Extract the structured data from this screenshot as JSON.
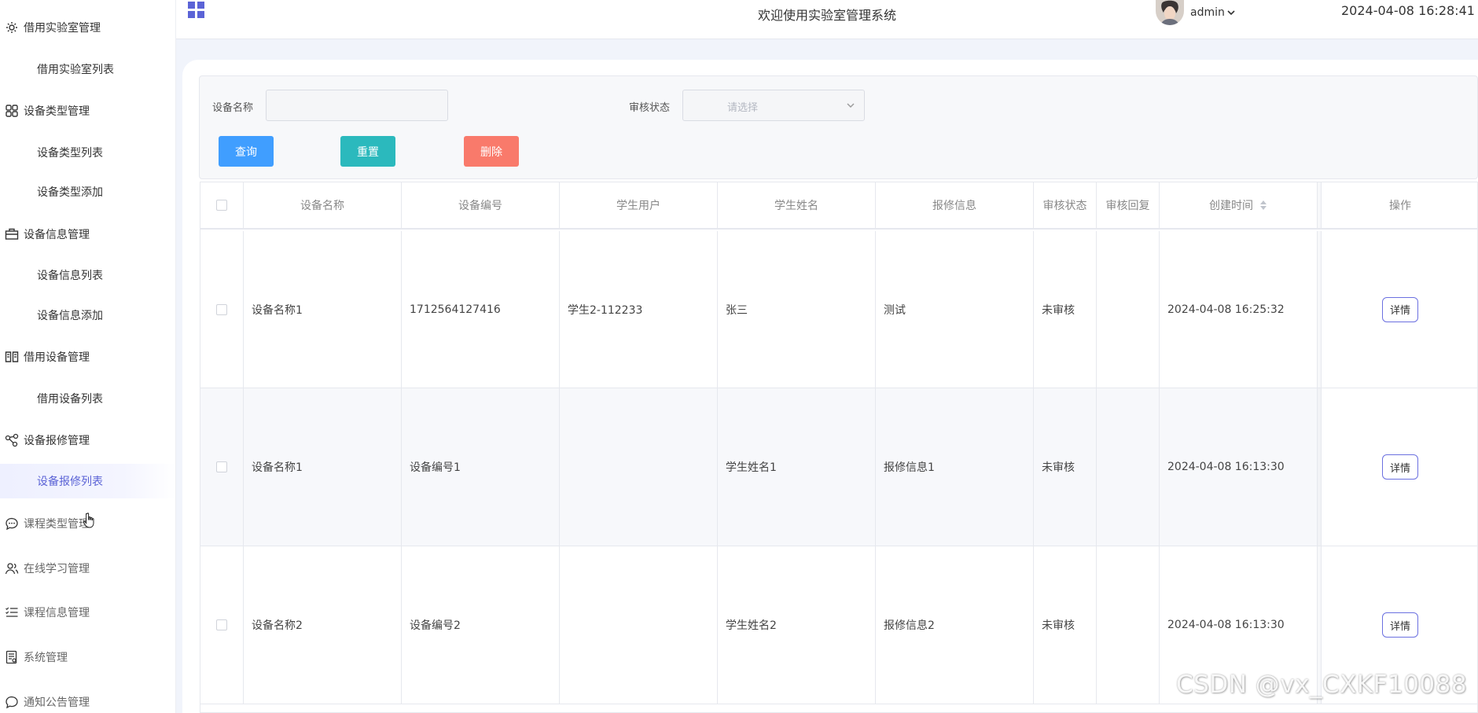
{
  "header": {
    "title": "欢迎使用实验室管理系统",
    "username": "admin",
    "datetime": "2024-04-08 16:28:41"
  },
  "sidebar": {
    "groups": [
      {
        "label": "借用实验室管理",
        "icon": "gear-icon",
        "items": [
          "借用实验室列表"
        ]
      },
      {
        "label": "设备类型管理",
        "icon": "grid-icon",
        "items": [
          "设备类型列表",
          "设备类型添加"
        ]
      },
      {
        "label": "设备信息管理",
        "icon": "briefcase-icon",
        "items": [
          "设备信息列表",
          "设备信息添加"
        ]
      },
      {
        "label": "借用设备管理",
        "icon": "book-icon",
        "items": [
          "借用设备列表"
        ]
      },
      {
        "label": "设备报修管理",
        "icon": "share-icon",
        "items": [
          "设备报修列表"
        ]
      },
      {
        "label": "课程类型管理",
        "icon": "chat-icon",
        "items": []
      },
      {
        "label": "在线学习管理",
        "icon": "users-icon",
        "items": []
      },
      {
        "label": "课程信息管理",
        "icon": "list-icon",
        "items": []
      },
      {
        "label": "系统管理",
        "icon": "document-icon",
        "items": []
      },
      {
        "label": "通知公告管理",
        "icon": "chat-icon",
        "items": []
      }
    ],
    "active_item": "设备报修列表"
  },
  "search": {
    "device_name_label": "设备名称",
    "device_name_value": "",
    "status_label": "审核状态",
    "status_placeholder": "请选择"
  },
  "buttons": {
    "query": "查询",
    "reset": "重置",
    "delete": "删除"
  },
  "table": {
    "columns": [
      "设备名称",
      "设备编号",
      "学生用户",
      "学生姓名",
      "报修信息",
      "审核状态",
      "审核回复",
      "创建时间",
      "操作"
    ],
    "rows": [
      {
        "device_name": "设备名称1",
        "device_no": "1712564127416",
        "student_user": "学生2-112233",
        "student_name": "张三",
        "repair_info": "测试",
        "status": "未审核",
        "reply": "",
        "created": "2024-04-08 16:25:32",
        "action": "详情"
      },
      {
        "device_name": "设备名称1",
        "device_no": "设备编号1",
        "student_user": "",
        "student_name": "学生姓名1",
        "repair_info": "报修信息1",
        "status": "未审核",
        "reply": "",
        "created": "2024-04-08 16:13:30",
        "action": "详情"
      },
      {
        "device_name": "设备名称2",
        "device_no": "设备编号2",
        "student_user": "",
        "student_name": "学生姓名2",
        "repair_info": "报修信息2",
        "status": "未审核",
        "reply": "",
        "created": "2024-04-08 16:13:30",
        "action": "详情"
      }
    ]
  },
  "watermark": "CSDN @vx_CXKF10088"
}
